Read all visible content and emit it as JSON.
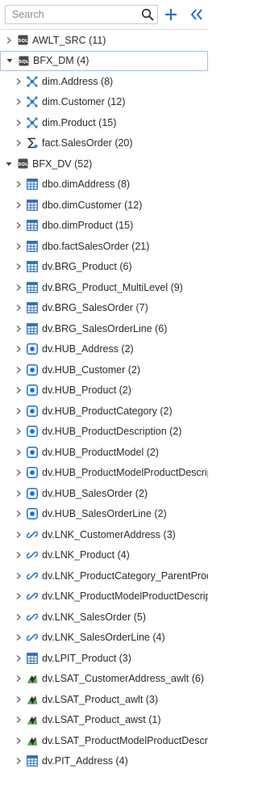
{
  "search": {
    "placeholder": "Search",
    "value": ""
  },
  "toolbar": {
    "add_symbol": "+",
    "collapse_symbol": "«"
  },
  "tree": [
    {
      "label": "AWLT_SRC (11)",
      "level": 0,
      "expanded": false,
      "icon": "sql-db-icon"
    },
    {
      "label": "BFX_DM (4)",
      "level": 0,
      "expanded": true,
      "icon": "sql-db-icon",
      "selected": true
    },
    {
      "label": "dim.Address (8)",
      "level": 1,
      "expanded": false,
      "icon": "dimension-icon"
    },
    {
      "label": "dim.Customer (12)",
      "level": 1,
      "expanded": false,
      "icon": "dimension-icon"
    },
    {
      "label": "dim.Product (15)",
      "level": 1,
      "expanded": false,
      "icon": "dimension-icon"
    },
    {
      "label": "fact.SalesOrder (20)",
      "level": 1,
      "expanded": false,
      "icon": "fact-icon"
    },
    {
      "label": "BFX_DV (52)",
      "level": 0,
      "expanded": true,
      "icon": "sql-db-icon"
    },
    {
      "label": "dbo.dimAddress (8)",
      "level": 1,
      "expanded": false,
      "icon": "table-icon"
    },
    {
      "label": "dbo.dimCustomer (12)",
      "level": 1,
      "expanded": false,
      "icon": "table-icon"
    },
    {
      "label": "dbo.dimProduct (15)",
      "level": 1,
      "expanded": false,
      "icon": "table-icon"
    },
    {
      "label": "dbo.factSalesOrder (21)",
      "level": 1,
      "expanded": false,
      "icon": "table-icon"
    },
    {
      "label": "dv.BRG_Product (6)",
      "level": 1,
      "expanded": false,
      "icon": "table-icon"
    },
    {
      "label": "dv.BRG_Product_MultiLevel (9)",
      "level": 1,
      "expanded": false,
      "icon": "table-icon"
    },
    {
      "label": "dv.BRG_SalesOrder (7)",
      "level": 1,
      "expanded": false,
      "icon": "table-icon"
    },
    {
      "label": "dv.BRG_SalesOrderLine (6)",
      "level": 1,
      "expanded": false,
      "icon": "table-icon"
    },
    {
      "label": "dv.HUB_Address (2)",
      "level": 1,
      "expanded": false,
      "icon": "hub-icon"
    },
    {
      "label": "dv.HUB_Customer (2)",
      "level": 1,
      "expanded": false,
      "icon": "hub-icon"
    },
    {
      "label": "dv.HUB_Product (2)",
      "level": 1,
      "expanded": false,
      "icon": "hub-icon"
    },
    {
      "label": "dv.HUB_ProductCategory (2)",
      "level": 1,
      "expanded": false,
      "icon": "hub-icon"
    },
    {
      "label": "dv.HUB_ProductDescription (2)",
      "level": 1,
      "expanded": false,
      "icon": "hub-icon"
    },
    {
      "label": "dv.HUB_ProductModel (2)",
      "level": 1,
      "expanded": false,
      "icon": "hub-icon"
    },
    {
      "label": "dv.HUB_ProductModelProductDescript...",
      "level": 1,
      "expanded": false,
      "icon": "hub-icon"
    },
    {
      "label": "dv.HUB_SalesOrder (2)",
      "level": 1,
      "expanded": false,
      "icon": "hub-icon"
    },
    {
      "label": "dv.HUB_SalesOrderLine (2)",
      "level": 1,
      "expanded": false,
      "icon": "hub-icon"
    },
    {
      "label": "dv.LNK_CustomerAddress (3)",
      "level": 1,
      "expanded": false,
      "icon": "link-icon"
    },
    {
      "label": "dv.LNK_Product (4)",
      "level": 1,
      "expanded": false,
      "icon": "link-icon"
    },
    {
      "label": "dv.LNK_ProductCategory_ParentProdu...",
      "level": 1,
      "expanded": false,
      "icon": "link-icon"
    },
    {
      "label": "dv.LNK_ProductModelProductDescript...",
      "level": 1,
      "expanded": false,
      "icon": "link-icon"
    },
    {
      "label": "dv.LNK_SalesOrder (5)",
      "level": 1,
      "expanded": false,
      "icon": "link-icon"
    },
    {
      "label": "dv.LNK_SalesOrderLine (4)",
      "level": 1,
      "expanded": false,
      "icon": "link-icon"
    },
    {
      "label": "dv.LPIT_Product (3)",
      "level": 1,
      "expanded": false,
      "icon": "table-icon"
    },
    {
      "label": "dv.LSAT_CustomerAddress_awlt (6)",
      "level": 1,
      "expanded": false,
      "icon": "satellite-icon"
    },
    {
      "label": "dv.LSAT_Product_awlt (3)",
      "level": 1,
      "expanded": false,
      "icon": "satellite-icon"
    },
    {
      "label": "dv.LSAT_Product_awst (1)",
      "level": 1,
      "expanded": false,
      "icon": "satellite-icon"
    },
    {
      "label": "dv.LSAT_ProductModelProductDescrip...",
      "level": 1,
      "expanded": false,
      "icon": "satellite-icon"
    },
    {
      "label": "dv.PIT_Address (4)",
      "level": 1,
      "expanded": false,
      "icon": "table-icon"
    }
  ],
  "colors": {
    "accent": "#1f6fd1",
    "chevron": "#6b6b6b",
    "db_icon": "#4a4a4a",
    "dimension_icon": "#2a7fc9",
    "table_icon": "#2f6fb5",
    "hub_icon": "#1f6fd1",
    "link_icon": "#2a7fc9",
    "satellite_dark": "#2e2e2e",
    "satellite_green": "#4caf50",
    "selected_border": "#9cc3e8"
  }
}
